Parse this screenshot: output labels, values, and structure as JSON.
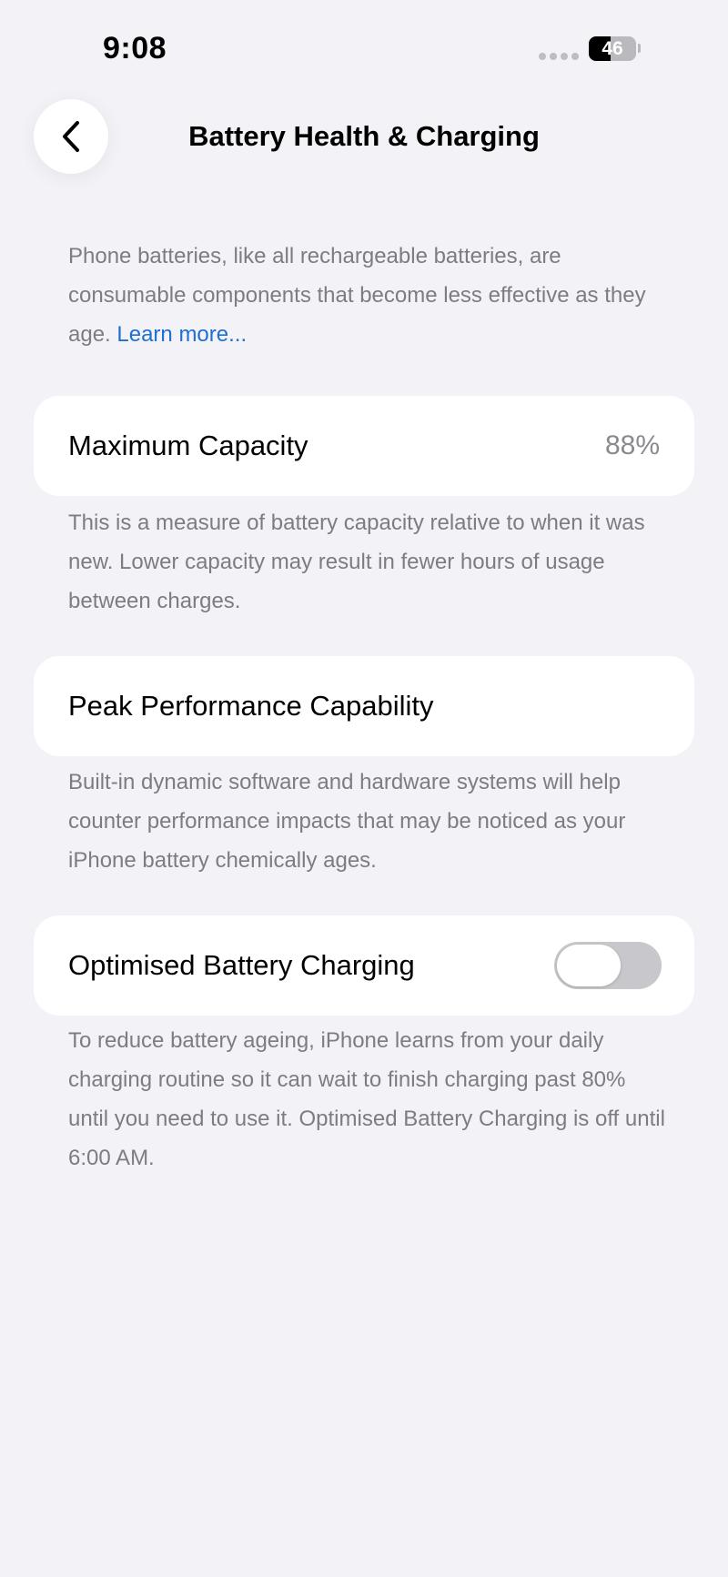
{
  "status_bar": {
    "time": "9:08",
    "battery_level": "46",
    "battery_fraction": 0.46
  },
  "header": {
    "title": "Battery Health & Charging"
  },
  "intro": {
    "text": "Phone batteries, like all rechargeable batteries, are consumable components that become less effective as they age. ",
    "link_label": "Learn more..."
  },
  "maximum_capacity": {
    "label": "Maximum Capacity",
    "value": "88%",
    "description": "This is a measure of battery capacity relative to when it was new. Lower capacity may result in fewer hours of usage between charges."
  },
  "peak_performance": {
    "label": "Peak Performance Capability",
    "description": "Built-in dynamic software and hardware systems will help counter performance impacts that may be noticed as your iPhone battery chemically ages."
  },
  "optimised_charging": {
    "label": "Optimised Battery Charging",
    "enabled": false,
    "description": "To reduce battery ageing, iPhone learns from your daily charging routine so it can wait to finish charging past 80% until you need to use it. Optimised Battery Charging is off until 6:00 AM."
  },
  "colors": {
    "background": "#f2f2f7",
    "card": "#ffffff",
    "secondary_text": "#7c7c82",
    "link": "#1f6fd1",
    "toggle_off": "#c8c8cc"
  }
}
